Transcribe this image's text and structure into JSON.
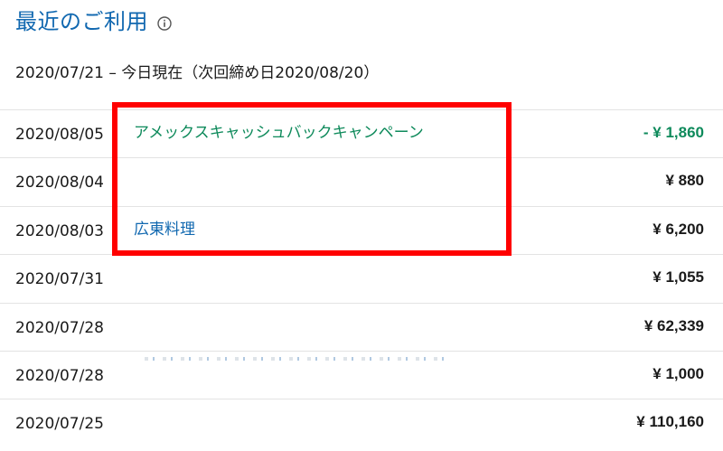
{
  "header": {
    "title": "最近のご利用",
    "info_icon": "info-icon"
  },
  "period": "2020/07/21 – 今日現在（次回締め日2020/08/20）",
  "colors": {
    "title": "#1168b0",
    "credit": "#0e8a5b",
    "highlight": "#ff0000"
  },
  "transactions": [
    {
      "date": "2020/08/05",
      "description": "アメックスキャッシュバックキャンペーン",
      "amount": "- ¥ 1,860"
    },
    {
      "date": "2020/08/04",
      "description": "",
      "amount": "¥ 880"
    },
    {
      "date": "2020/08/03",
      "description": "広東料理",
      "amount": "¥ 6,200"
    },
    {
      "date": "2020/07/31",
      "description": "",
      "amount": "¥ 1,055"
    },
    {
      "date": "2020/07/28",
      "description": "",
      "amount": "¥ 62,339"
    },
    {
      "date": "2020/07/28",
      "description": "",
      "amount": "¥ 1,000"
    },
    {
      "date": "2020/07/25",
      "description": "",
      "amount": "¥ 110,160"
    }
  ]
}
